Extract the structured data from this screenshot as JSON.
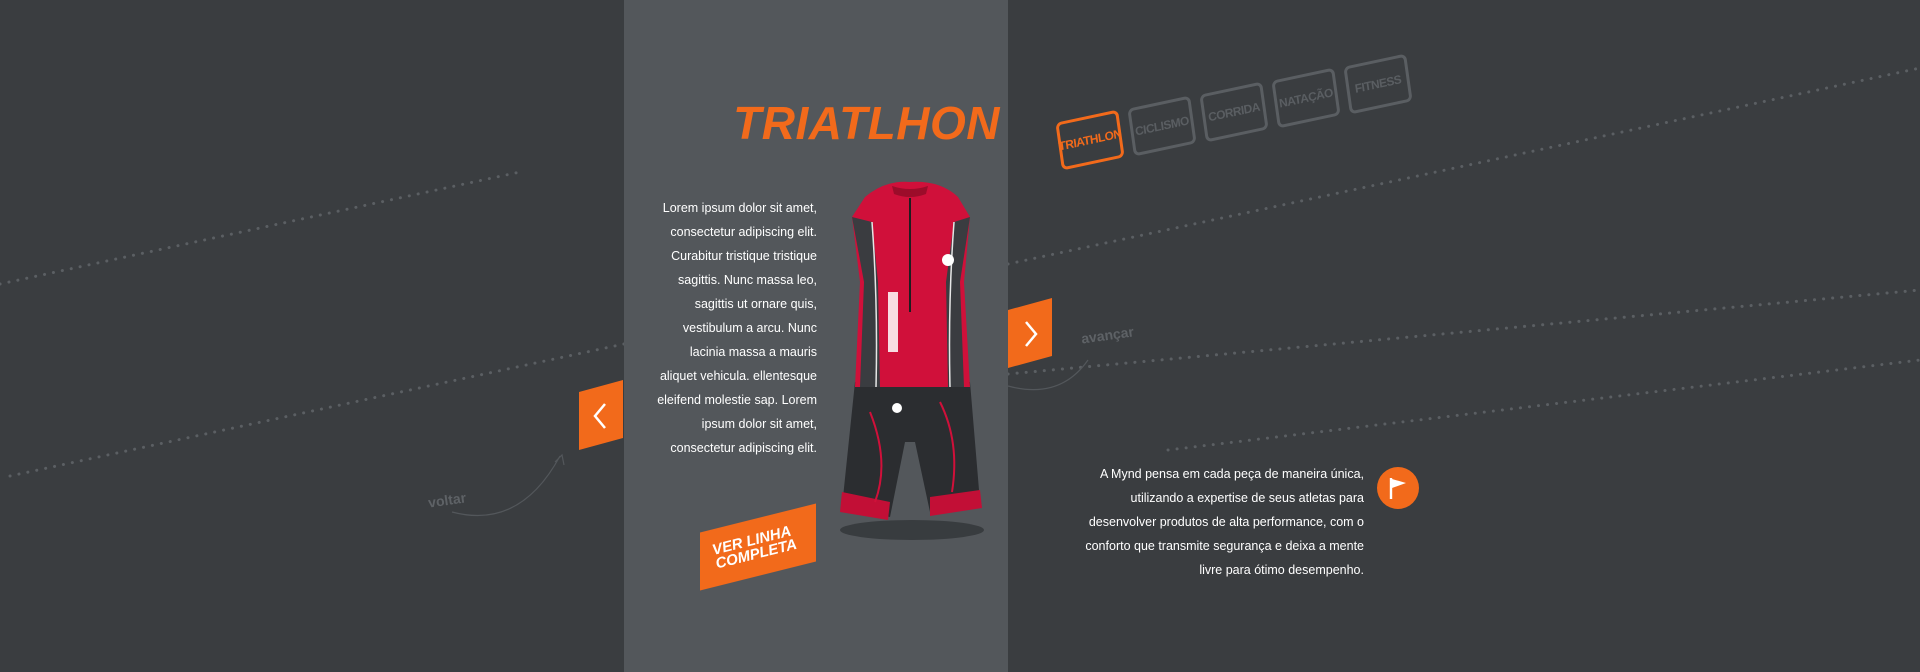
{
  "hero": {
    "title": "TRIATLHON",
    "description": "Lorem ipsum dolor sit amet, consectetur adipiscing elit. Curabitur tristique tristique sagittis. Nunc massa leo, sagittis ut ornare quis, vestibulum a arcu. Nunc lacinia massa a mauris aliquet vehicula. ellentesque eleifend molestie sap. Lorem ipsum dolor sit amet, consectetur adipiscing elit.",
    "cta_label": "VER LINHA COMPLETA"
  },
  "navigation": {
    "prev_label": "voltar",
    "next_label": "avançar"
  },
  "categories": [
    {
      "label": "TRIATHLON",
      "active": true
    },
    {
      "label": "CICLISMO",
      "active": false
    },
    {
      "label": "CORRIDA",
      "active": false
    },
    {
      "label": "NATAÇÃO",
      "active": false
    },
    {
      "label": "FITNESS",
      "active": false
    }
  ],
  "about": {
    "text": "A Mynd pensa em cada peça de maneira única, utilizando a expertise de seus atletas para desenvolver produtos de alta performance, com o conforto que transmite segurança e deixa a mente livre para ótimo desempenho."
  },
  "colors": {
    "accent": "#f26a1b",
    "background": "#3a3d40",
    "panel": "#53575b",
    "product_red": "#d0103a"
  },
  "icons": {
    "prev": "chevron-left-icon",
    "next": "chevron-right-icon",
    "about": "flag-icon"
  }
}
